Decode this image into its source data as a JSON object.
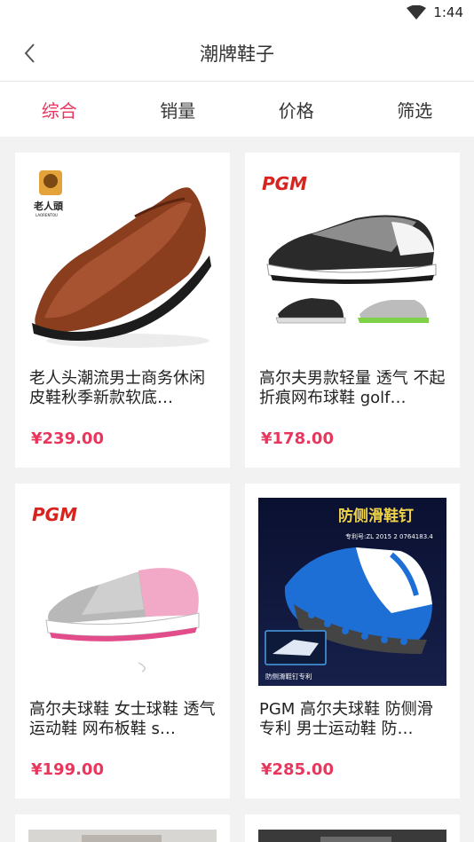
{
  "status": {
    "time": "1:44"
  },
  "header": {
    "title": "潮牌鞋子"
  },
  "filters": [
    {
      "label": "综合",
      "active": true
    },
    {
      "label": "销量",
      "active": false
    },
    {
      "label": "价格",
      "active": false
    },
    {
      "label": "筛选",
      "active": false
    }
  ],
  "products": [
    {
      "title": "老人头潮流男士商务休闲皮鞋秋季新款软底…",
      "price": "¥239.00",
      "brand": "老人頭",
      "brand_sub": "LAORENTOU"
    },
    {
      "title": "高尔夫男款轻量 透气 不起折痕网布球鞋 golf…",
      "price": "¥178.00",
      "brand": "PGM"
    },
    {
      "title": "高尔夫球鞋 女士球鞋 透气运动鞋 网布板鞋 s…",
      "price": "¥199.00",
      "brand": "PGM"
    },
    {
      "title": "PGM 高尔夫球鞋 防侧滑专利 男士运动鞋 防…",
      "price": "¥285.00",
      "banner": "防侧滑鞋钉",
      "patent": "专利号:ZL 2015 2 0764183.4",
      "inset_label": "防侧滑鞋钉专利"
    }
  ],
  "colors": {
    "accent": "#e8365d"
  }
}
